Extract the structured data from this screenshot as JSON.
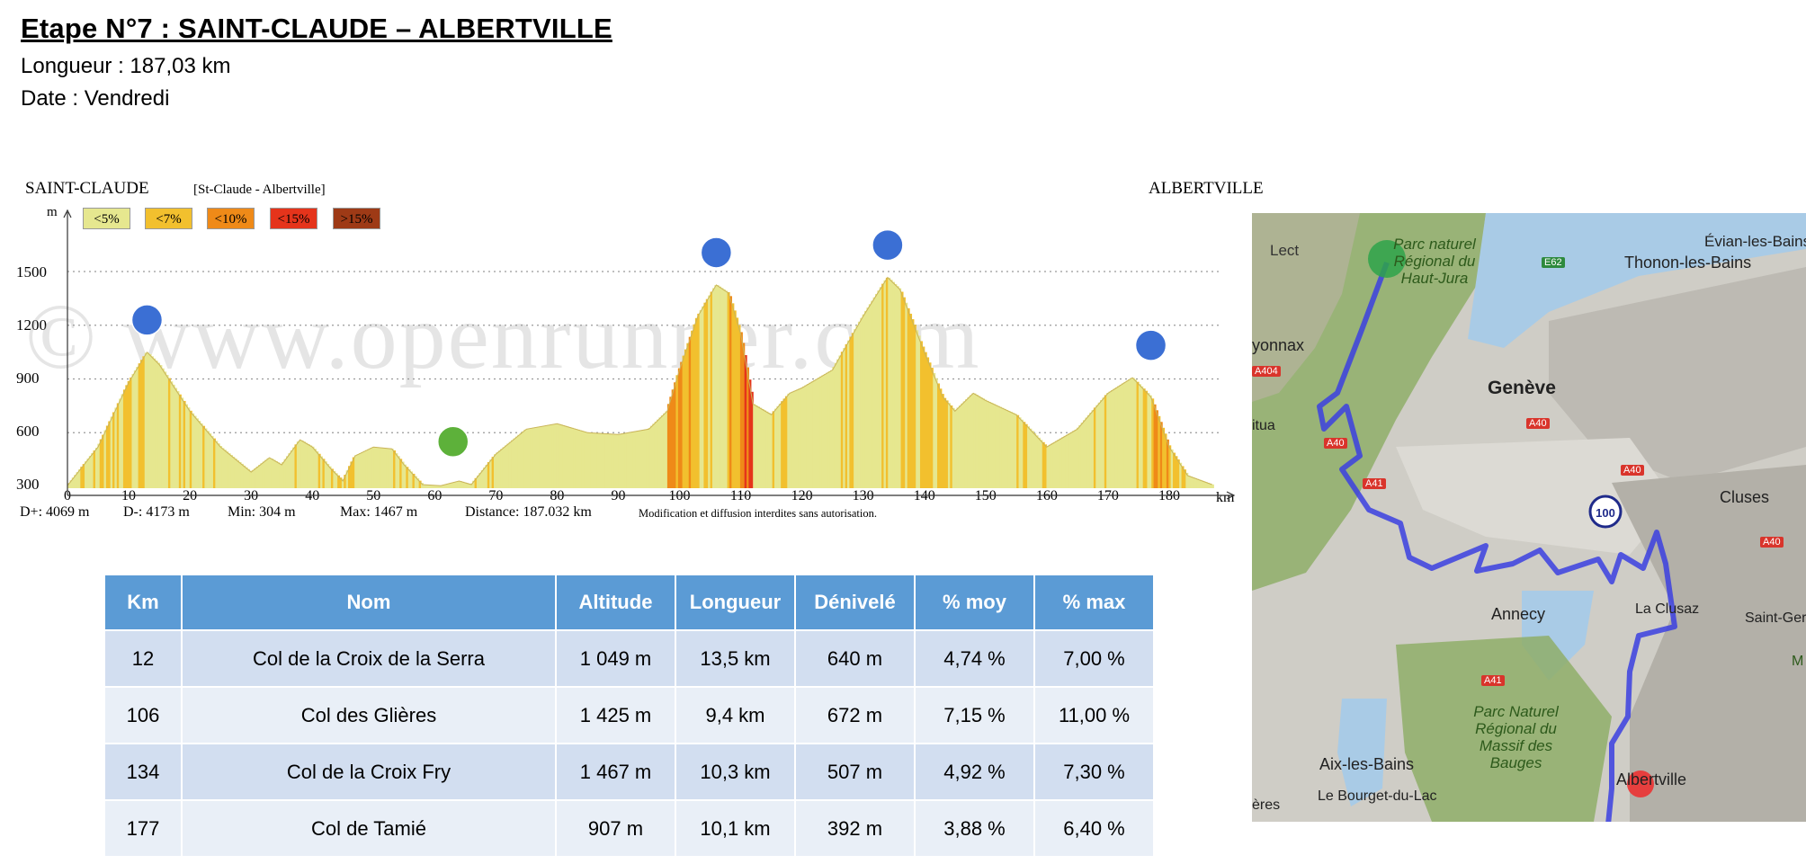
{
  "header": {
    "title": "Etape N°7 : SAINT-CLAUDE – ALBERTVILLE",
    "length": "Longueur : 187,03 km",
    "date": "Date : Vendredi"
  },
  "profile": {
    "start": "SAINT-CLAUDE",
    "route": "[St-Claude - Albertville]",
    "end": "ALBERTVILLE",
    "y_unit": "m",
    "x_unit": "km",
    "watermark": "© www.openrunner.com",
    "legend": [
      {
        "label": "<5%",
        "color": "#e6e78f"
      },
      {
        "label": "<7%",
        "color": "#f2c02e"
      },
      {
        "label": "<10%",
        "color": "#ef8a18"
      },
      {
        "label": "<15%",
        "color": "#e5341b"
      },
      {
        "label": ">15%",
        "color": "#9e3a16"
      }
    ],
    "y_ticks": [
      "1500",
      "1200",
      "900",
      "600",
      "300"
    ],
    "x_ticks": [
      "0",
      "10",
      "20",
      "30",
      "40",
      "50",
      "60",
      "70",
      "80",
      "90",
      "100",
      "110",
      "120",
      "130",
      "140",
      "150",
      "160",
      "170",
      "180"
    ],
    "stats": {
      "dplus": "D+: 4069 m",
      "dminus": "D-: 4173 m",
      "min": "Min: 304 m",
      "max": "Max: 1467 m",
      "distance": "Distance: 187.032 km",
      "notice": "Modification et diffusion interdites sans autorisation."
    }
  },
  "chart_data": {
    "type": "area",
    "x": [
      0,
      5,
      10,
      13,
      15,
      20,
      25,
      30,
      33,
      35,
      38,
      40,
      43,
      45,
      47,
      50,
      53,
      55,
      58,
      61,
      64,
      66,
      70,
      75,
      80,
      85,
      90,
      95,
      98,
      100,
      103,
      106,
      108,
      110,
      112,
      115,
      118,
      120,
      125,
      130,
      134,
      136,
      140,
      143,
      145,
      148,
      150,
      155,
      160,
      165,
      170,
      174,
      177,
      180,
      183,
      187
    ],
    "y": [
      304,
      520,
      880,
      1049,
      980,
      720,
      520,
      380,
      460,
      420,
      560,
      520,
      400,
      330,
      470,
      520,
      510,
      420,
      310,
      304,
      330,
      310,
      480,
      620,
      650,
      600,
      590,
      620,
      720,
      950,
      1250,
      1425,
      1380,
      1150,
      760,
      700,
      820,
      850,
      950,
      1250,
      1467,
      1400,
      1050,
      800,
      720,
      820,
      780,
      700,
      520,
      620,
      820,
      907,
      800,
      520,
      360,
      310
    ],
    "xlim": [
      0,
      187
    ],
    "ylim": [
      300,
      1600
    ],
    "xlabel": "km",
    "ylabel": "m",
    "markers": [
      {
        "x": 13,
        "y": 1049,
        "kind": "col"
      },
      {
        "x": 63,
        "y": 304,
        "kind": "sprint"
      },
      {
        "x": 106,
        "y": 1425,
        "kind": "col"
      },
      {
        "x": 134,
        "y": 1467,
        "kind": "col"
      },
      {
        "x": 177,
        "y": 907,
        "kind": "col"
      }
    ]
  },
  "climbs_table": {
    "headers": [
      "Km",
      "Nom",
      "Altitude",
      "Longueur",
      "Dénivelé",
      "% moy",
      "% max"
    ],
    "rows": [
      [
        "12",
        "Col de la Croix de la Serra",
        "1 049 m",
        "13,5 km",
        "640 m",
        "4,74 %",
        "7,00 %"
      ],
      [
        "106",
        "Col des Glières",
        "1 425 m",
        "9,4 km",
        "672 m",
        "7,15 %",
        "11,00 %"
      ],
      [
        "134",
        "Col de la Croix Fry",
        "1 467 m",
        "10,3 km",
        "507 m",
        "4,92 %",
        "7,30 %"
      ],
      [
        "177",
        "Col de Tamié",
        "907 m",
        "10,1 km",
        "392 m",
        "3,88 %",
        "6,40 %"
      ]
    ]
  },
  "map": {
    "labels": {
      "lect": "Lect",
      "parc_jura": "Parc naturel Régional du Haut-Jura",
      "evian": "Évian-les-Bains",
      "thonon": "Thonon-les-Bains",
      "oyonnax": "yonnax",
      "geneve": "Genève",
      "nantua": "itua",
      "cluses": "Cluses",
      "annecy": "Annecy",
      "clusaz": "La Clusaz",
      "saint_gervais": "Saint-Gerv",
      "aix": "Aix-les-Bains",
      "parc_bauges": "Parc Naturel Régional du Massif des Bauges",
      "albertville": "Albertville",
      "bourget": "Le Bourget-du-Lac",
      "eres": "ères",
      "m": "M"
    },
    "roads": [
      "E62",
      "A40",
      "A40",
      "A40",
      "A40",
      "A41",
      "A41",
      "A404"
    ],
    "km_marker": "100"
  }
}
